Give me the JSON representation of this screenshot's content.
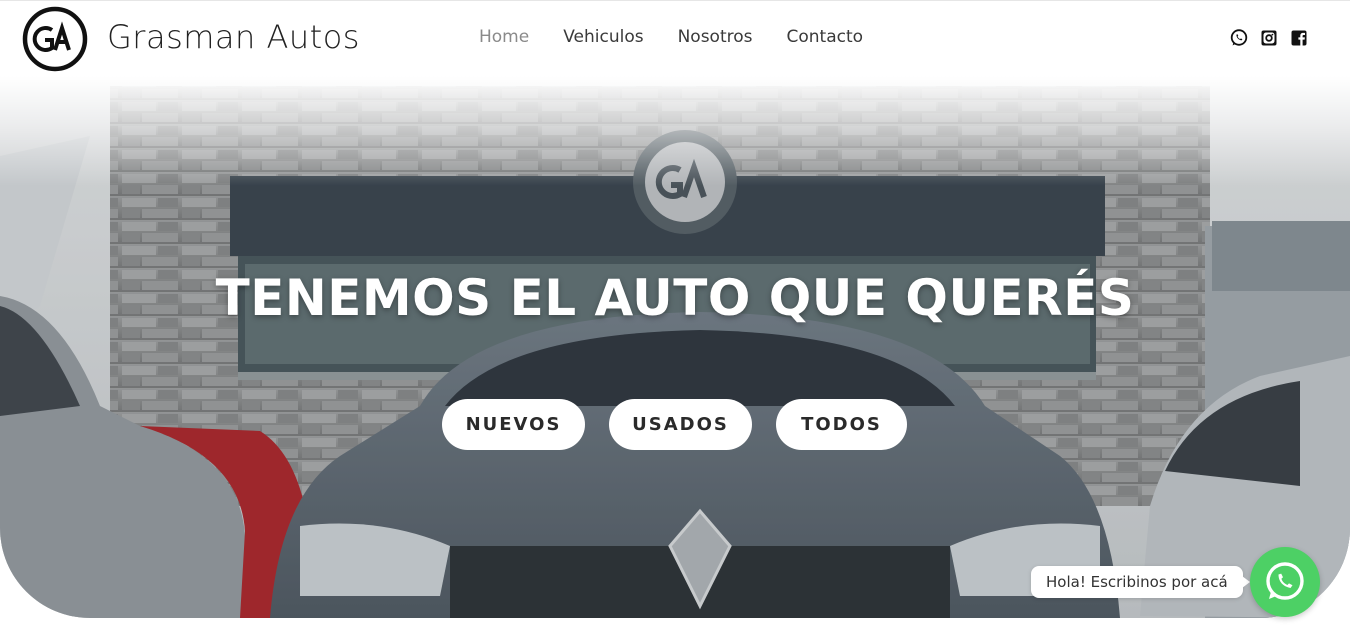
{
  "brand": {
    "name": "Grasman Autos",
    "logo_text": "GA"
  },
  "nav": {
    "items": [
      {
        "label": "Home",
        "active": true
      },
      {
        "label": "Vehiculos",
        "active": false
      },
      {
        "label": "Nosotros",
        "active": false
      },
      {
        "label": "Contacto",
        "active": false
      }
    ]
  },
  "social": {
    "icons": [
      "whatsapp-icon",
      "instagram-icon",
      "facebook-icon"
    ]
  },
  "hero": {
    "title": "TENEMOS EL AUTO QUE QUERÉS",
    "buttons": [
      {
        "label": "NUEVOS"
      },
      {
        "label": "USADOS"
      },
      {
        "label": "TODOS"
      }
    ]
  },
  "whatsapp_chat": {
    "bubble_text": "Hola! Escribinos por acá",
    "icon": "whatsapp-icon"
  },
  "colors": {
    "accent_text": "#222222",
    "nav_active": "#8a8a8a",
    "whatsapp_green": "#4dd065"
  }
}
